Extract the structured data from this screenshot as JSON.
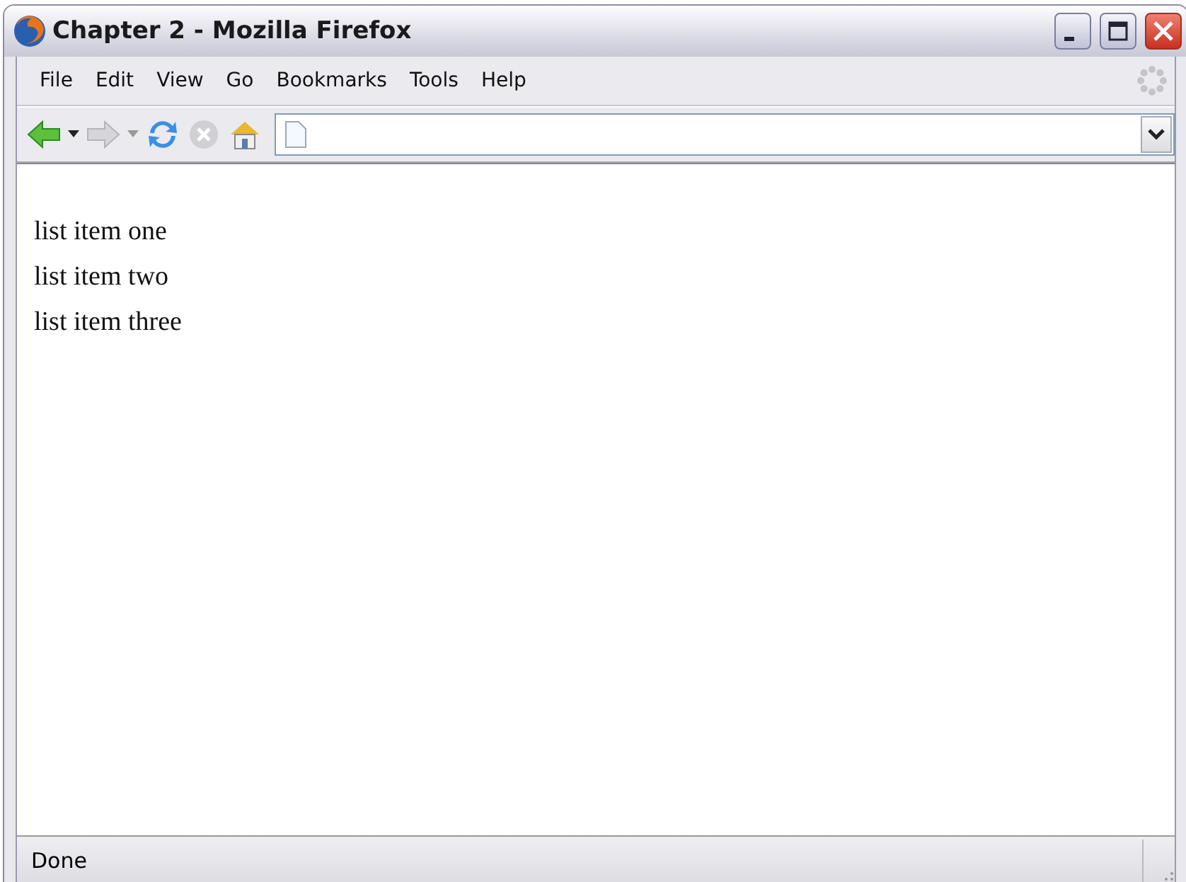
{
  "window": {
    "title": "Chapter 2 - Mozilla Firefox"
  },
  "menu": [
    "File",
    "Edit",
    "View",
    "Go",
    "Bookmarks",
    "Tools",
    "Help"
  ],
  "content": {
    "items": [
      "list item one",
      "list item two",
      "list item three"
    ]
  },
  "status_bar": {
    "text": "Done"
  }
}
